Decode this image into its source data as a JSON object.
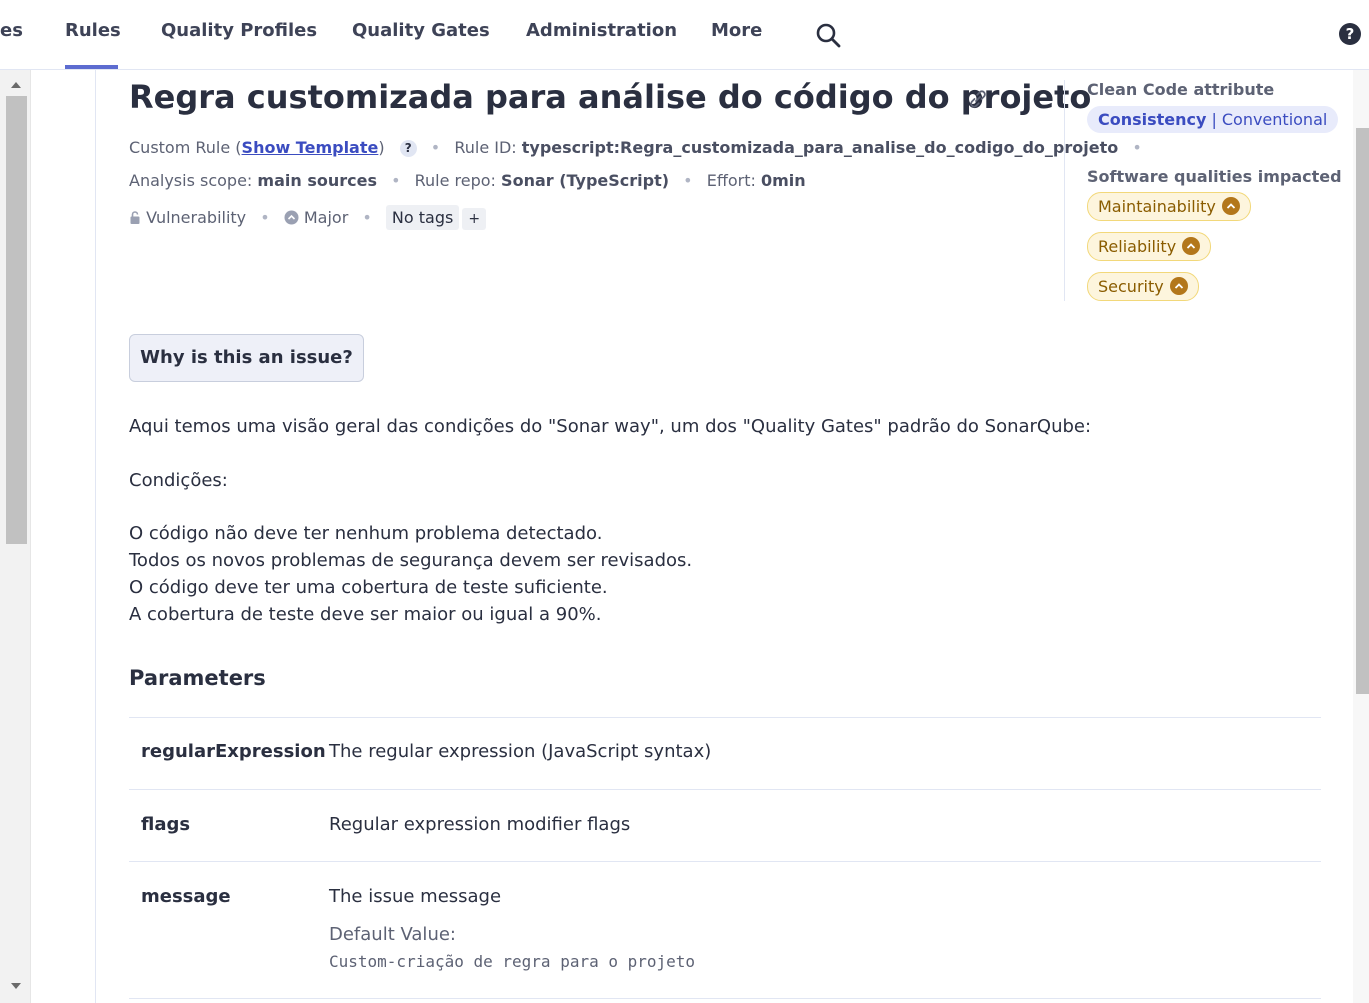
{
  "nav": {
    "items": [
      "es",
      "Rules",
      "Quality Profiles",
      "Quality Gates",
      "Administration",
      "More"
    ],
    "active": "Rules"
  },
  "rule": {
    "title": "Regra customizada para análise do código do projeto",
    "custom_rule_prefix": "Custom Rule (",
    "show_template": "Show Template",
    "custom_rule_suffix": ")",
    "help_mark": "?",
    "rule_id_label": "Rule ID:",
    "rule_id": "typescript:Regra_customizada_para_analise_do_codigo_do_projeto",
    "scope_label": "Analysis scope:",
    "scope": "main sources",
    "repo_label": "Rule repo:",
    "repo": "Sonar (TypeScript)",
    "effort_label": "Effort:",
    "effort": "0min",
    "type": "Vulnerability",
    "severity": "Major",
    "tags": "No tags",
    "add_tag": "+"
  },
  "why_button": "Why is this an issue?",
  "description": {
    "intro": "Aqui temos uma visão geral das condições do \"Sonar way\", um dos \"Quality Gates\" padrão do SonarQube:",
    "conditions_label": "Condições:",
    "lines": [
      "O código não deve ter nenhum problema detectado.",
      "Todos os novos problemas de segurança devem ser revisados.",
      "O código deve ter uma cobertura de teste suficiente.",
      "A cobertura de teste deve ser maior ou igual a 90%."
    ]
  },
  "parameters": {
    "title": "Parameters",
    "rows": [
      {
        "name": "regularExpression",
        "description": "The regular expression (JavaScript syntax)"
      },
      {
        "name": "flags",
        "description": "Regular expression modifier flags"
      },
      {
        "name": "message",
        "description": "The issue message",
        "default_label": "Default Value:",
        "default_value": "Custom-criação de regra para o projeto"
      }
    ]
  },
  "side": {
    "clean_code_heading": "Clean Code attribute",
    "clean_code_category": "Consistency",
    "clean_code_attribute": "Conventional",
    "qualities_heading": "Software qualities impacted",
    "qualities": [
      "Maintainability",
      "Reliability",
      "Security"
    ]
  },
  "colors": {
    "accent": "#5d6cd0",
    "link": "#3b4cc0",
    "quality_bg": "#fdf5dd",
    "severity_icon": "#b3771b"
  },
  "icons": {
    "search": "search-icon",
    "help": "help-icon",
    "link": "link-icon",
    "lock": "lock-icon",
    "severity": "severity-major-icon"
  }
}
